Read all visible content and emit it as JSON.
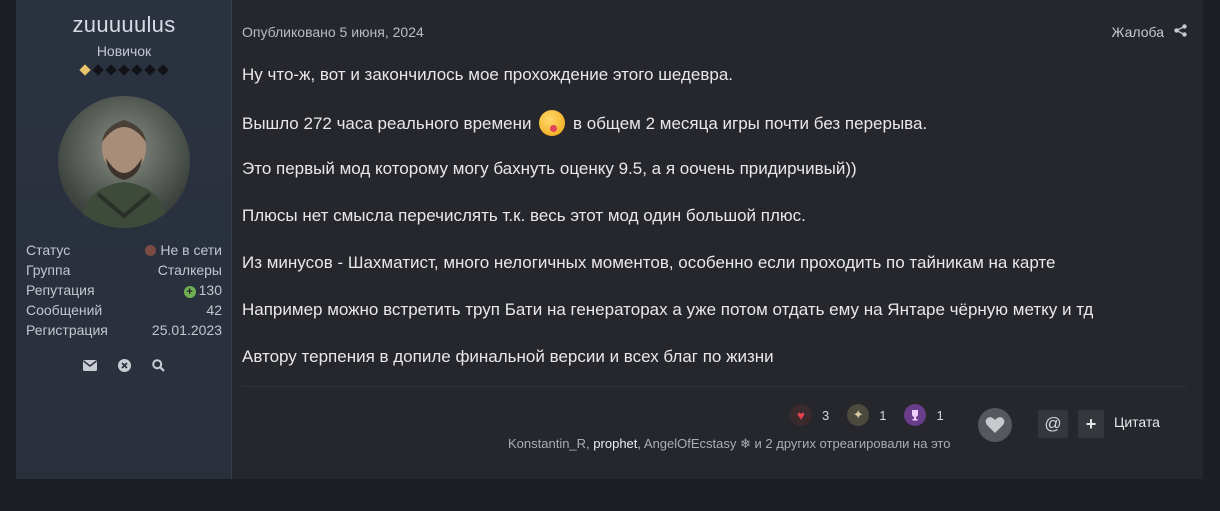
{
  "author": {
    "username": "zuuuuulus",
    "rank": "Новичок",
    "rank_pips_total": 7,
    "rank_pips_filled": 1,
    "stats": [
      {
        "label": "Статус",
        "value": "Не в сети"
      },
      {
        "label": "Группа",
        "value": "Сталкеры"
      },
      {
        "label": "Репутация",
        "value": "130"
      },
      {
        "label": "Сообщений",
        "value": "42"
      },
      {
        "label": "Регистрация",
        "value": "25.01.2023"
      }
    ],
    "actions": [
      "envelope-icon",
      "block-icon",
      "search-icon"
    ]
  },
  "post": {
    "published": "Опубликовано 5 июня, 2024",
    "report_label": "Жалоба",
    "paragraphs": [
      "Ну что-ж, вот и закончилось мое прохождение этого шедевра.",
      "Вышло 272 часа реального времени",
      "в общем 2 месяца игры почти без перерыва.",
      "Это первый мод которому могу бахнуть оценку 9.5, а я оочень придирчивый))",
      "Плюсы нет смысла перечислять т.к. весь этот мод один большой плюс.",
      "Из минусов - Шахматист, много нелогичных моментов, особенно если проходить по тайникам на карте",
      "Например можно встретить труп Бати на генераторах а уже потом отдать ему на Янтаре чёрную метку и тд",
      "Автору терпения в допиле финальной версии и всех благ по жизни"
    ]
  },
  "reactions": [
    {
      "icon": "heart-icon",
      "count": "3"
    },
    {
      "icon": "tank-icon",
      "count": "1"
    },
    {
      "icon": "trophy-icon",
      "count": "1"
    }
  ],
  "reacted_by": {
    "user1": "Konstantin_R",
    "sep1": ", ",
    "user2": "prophet",
    "sep2": ", ",
    "user3": "AngelOfEcstasy",
    "rest": " и 2 других отреагировали на это"
  },
  "buttons": {
    "mention": "@",
    "add": "+",
    "quote": "Цитата"
  },
  "colors": {
    "reputation": "#8fc56b",
    "offline_dot": "#7a4a44",
    "rank_pip": "#e8c36a"
  }
}
